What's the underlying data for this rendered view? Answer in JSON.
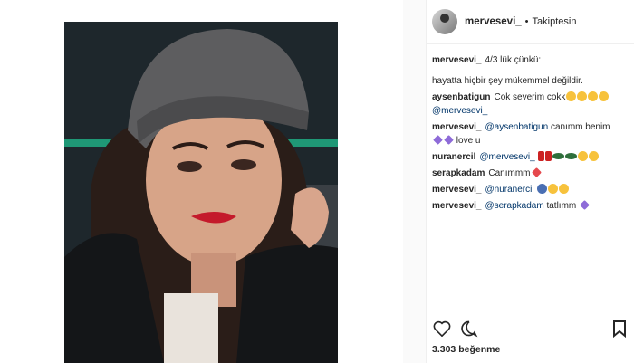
{
  "post": {
    "username": "mervesevi_",
    "separator": "•",
    "follow_status": "Takiptesin",
    "caption_user": "mervesevi_",
    "caption_line1": "4/3 lük çünkü:",
    "caption_line2": "hayatta hiçbir şey mükemmel değildir.",
    "likes": "3.303 beğenme"
  },
  "comments": [
    {
      "user": "aysenbatigun",
      "text": "Cok severim cokk",
      "mention": "@mervesevi_"
    },
    {
      "user": "mervesevi_",
      "mention": "@aysenbatigun",
      "text": "canımm benim",
      "text2": "love u"
    },
    {
      "user": "nuranercil",
      "mention": "@mervesevi_",
      "text": ""
    },
    {
      "user": "serapkadam",
      "text": "Canımmm"
    },
    {
      "user": "mervesevi_",
      "mention": "@nuranercil",
      "text": ""
    },
    {
      "user": "mervesevi_",
      "mention": "@serapkadam",
      "text": "tatlımm"
    }
  ],
  "icons": {
    "like": "heart-icon",
    "comment": "comment-icon",
    "save": "bookmark-icon"
  }
}
